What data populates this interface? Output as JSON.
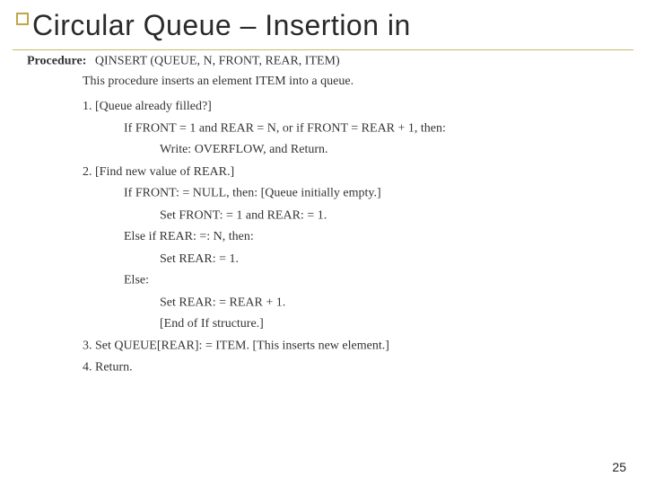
{
  "title": "Circular Queue – Insertion in",
  "procedure": {
    "label": "Procedure:",
    "signature": "QINSERT (QUEUE, N, FRONT, REAR, ITEM)",
    "description": "This procedure inserts an element ITEM into a queue.",
    "steps": [
      {
        "num": "1.",
        "heading": "[Queue already filled?]",
        "lines": [
          {
            "level": 1,
            "text": "If FRONT = 1 and REAR = N, or if FRONT = REAR + 1, then:"
          },
          {
            "level": 2,
            "text": "Write: OVERFLOW, and Return."
          }
        ]
      },
      {
        "num": "2.",
        "heading": "[Find new value of REAR.]",
        "lines": [
          {
            "level": 1,
            "text": "If FRONT: = NULL, then: [Queue initially empty.]"
          },
          {
            "level": 2,
            "text": "Set FRONT: = 1 and REAR: = 1."
          },
          {
            "level": 1,
            "text": "Else if REAR: =: N, then:"
          },
          {
            "level": 2,
            "text": "Set REAR: = 1."
          },
          {
            "level": 1,
            "text": "Else:"
          },
          {
            "level": 2,
            "text": "Set REAR: = REAR + 1."
          },
          {
            "level": 2,
            "text": "[End of If structure.]"
          }
        ]
      },
      {
        "num": "3.",
        "heading": "Set QUEUE[REAR]: = ITEM. [This inserts new element.]",
        "lines": []
      },
      {
        "num": "4.",
        "heading": "Return.",
        "lines": []
      }
    ]
  },
  "page_number": "25"
}
